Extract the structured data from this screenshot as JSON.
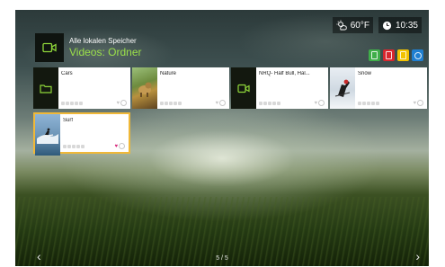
{
  "status": {
    "weather_icon": "sun-cloud-icon",
    "temperature": "60°F",
    "clock_icon": "clock-icon",
    "time": "10:35"
  },
  "header": {
    "icon": "video-camera-icon",
    "subtitle": "Alle lokalen Speicher",
    "title": "Videos: Ordner"
  },
  "color_keys": [
    {
      "name": "green",
      "color": "#3fae49"
    },
    {
      "name": "red",
      "color": "#d8262e"
    },
    {
      "name": "yellow",
      "color": "#f2c200"
    },
    {
      "name": "blue",
      "color": "#1f7fd1"
    }
  ],
  "tiles": [
    {
      "label": "Cars",
      "thumb": "folder-icon",
      "rating": 0,
      "favorite": false,
      "selected": false
    },
    {
      "label": "Nature",
      "thumb": "thumbnail-image",
      "rating": 0,
      "favorite": false,
      "selected": false
    },
    {
      "label": "NRQ- Half Bull, Hal...",
      "thumb": "video-camera-icon",
      "rating": 0,
      "favorite": false,
      "selected": false
    },
    {
      "label": "Snow",
      "thumb": "thumbnail-image",
      "rating": 0,
      "favorite": false,
      "selected": false
    },
    {
      "label": "Surf",
      "thumb": "thumbnail-image",
      "rating": 0,
      "favorite": true,
      "selected": true
    }
  ],
  "pager": {
    "text": "5 / 5"
  },
  "nav": {
    "prev_icon": "chevron-left-icon",
    "next_icon": "chevron-right-icon"
  }
}
